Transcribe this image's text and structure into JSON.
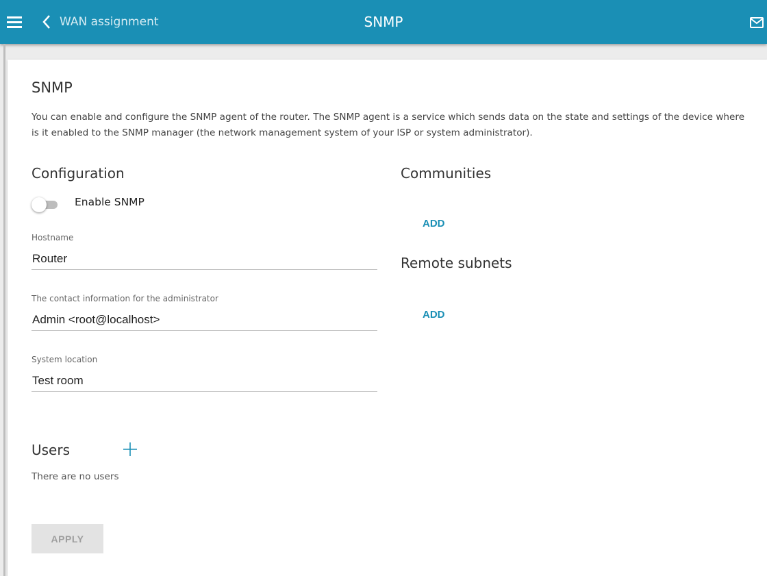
{
  "header": {
    "back_label": "WAN assignment",
    "title": "SNMP",
    "icons": [
      "menu-icon",
      "chevron-left-icon",
      "mail-icon"
    ],
    "color": "#1a8fb5"
  },
  "main": {
    "heading": "SNMP",
    "description": "You can enable and configure the SNMP agent of the router. The SNMP agent is a service which sends data on the state and settings of the device where is it enabled to the SNMP manager (the network management system of your ISP or system administrator).",
    "configuration": {
      "heading": "Configuration",
      "toggle_label": "Enable SNMP",
      "toggle_on": false,
      "fields": [
        {
          "label": "Hostname",
          "value": "Router"
        },
        {
          "label": "The contact information for the administrator",
          "value": "Admin <root@localhost>"
        },
        {
          "label": "System location",
          "value": "Test room"
        }
      ]
    },
    "communities": {
      "heading": "Communities",
      "add_label": "ADD"
    },
    "remote_subnets": {
      "heading": "Remote subnets",
      "add_label": "ADD"
    },
    "users": {
      "heading": "Users",
      "empty_text": "There are no users"
    },
    "apply_label": "APPLY"
  }
}
